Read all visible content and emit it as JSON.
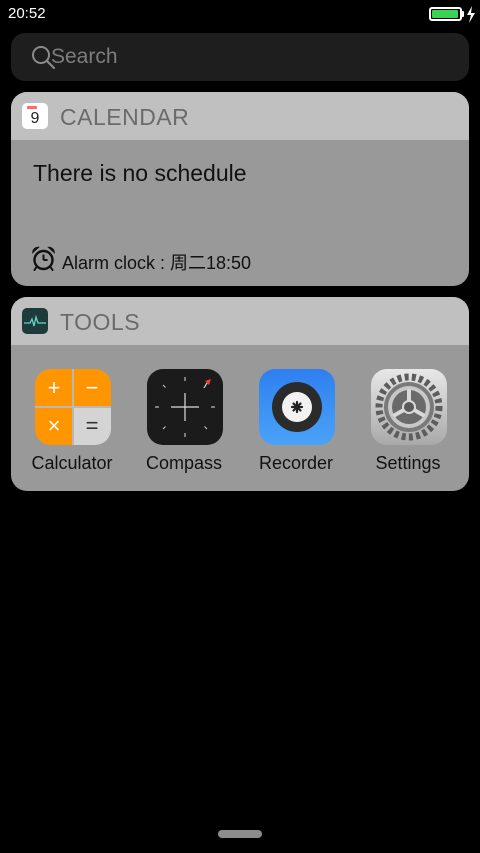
{
  "status_bar": {
    "time": "20:52",
    "battery_level_percent": 95,
    "battery_color": "#39d353",
    "charging": true
  },
  "search": {
    "placeholder": "Search",
    "icon": "search-icon"
  },
  "calendar_widget": {
    "title": "CALENDAR",
    "icon_day": "9",
    "schedule_text": "There is no schedule",
    "alarm_text": "Alarm clock : 周二18:50"
  },
  "tools_widget": {
    "title": "TOOLS",
    "apps": [
      {
        "label": "Calculator",
        "icon": "calculator-icon"
      },
      {
        "label": "Compass",
        "icon": "compass-icon"
      },
      {
        "label": "Recorder",
        "icon": "recorder-icon"
      },
      {
        "label": "Settings",
        "icon": "settings-gear-icon"
      }
    ],
    "calculator_symbols": [
      "+",
      "−",
      "×",
      "="
    ]
  },
  "colors": {
    "widget_body": "#999999",
    "widget_header": "#c0c0c0",
    "calculator_orange": "#ff9500",
    "recorder_blue": "#3a8ef0"
  }
}
